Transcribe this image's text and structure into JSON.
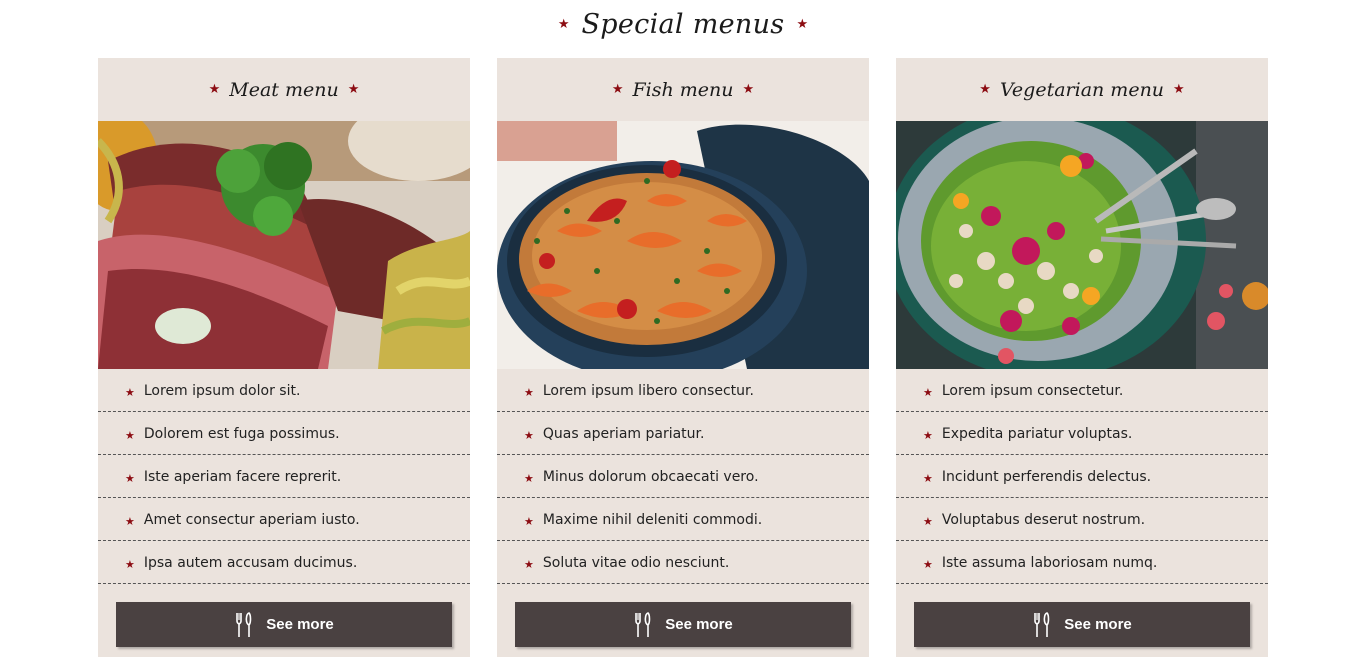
{
  "section": {
    "title": "Special menus"
  },
  "colors": {
    "accent": "#8c0c12",
    "card_bg": "#ebe3dd",
    "button_bg": "#4a4141"
  },
  "icons": {
    "star": "star-icon",
    "cutlery": "cutlery-icon"
  },
  "cards": [
    {
      "title": "Meat menu",
      "image": "steak-with-parsley-photo",
      "items": [
        "Lorem ipsum dolor sit.",
        "Dolorem est fuga possimus.",
        "Iste aperiam facere reprerit.",
        "Amet consectur aperiam iusto.",
        "Ipsa autem accusam ducimus."
      ],
      "button": "See more"
    },
    {
      "title": "Fish menu",
      "image": "paella-with-shrimp-photo",
      "items": [
        "Lorem ipsum libero consectur.",
        "Quas aperiam pariatur.",
        "Minus dolorum obcaecati vero.",
        "Maxime nihil deleniti commodi.",
        "Soluta vitae odio nesciunt."
      ],
      "button": "See more"
    },
    {
      "title": "Vegetarian menu",
      "image": "green-salad-with-flowers-photo",
      "items": [
        "Lorem ipsum consectetur.",
        "Expedita pariatur voluptas.",
        "Incidunt perferendis delectus.",
        "Voluptabus deserut nostrum.",
        "Iste assuma laboriosam numq."
      ],
      "button": "See more"
    }
  ]
}
